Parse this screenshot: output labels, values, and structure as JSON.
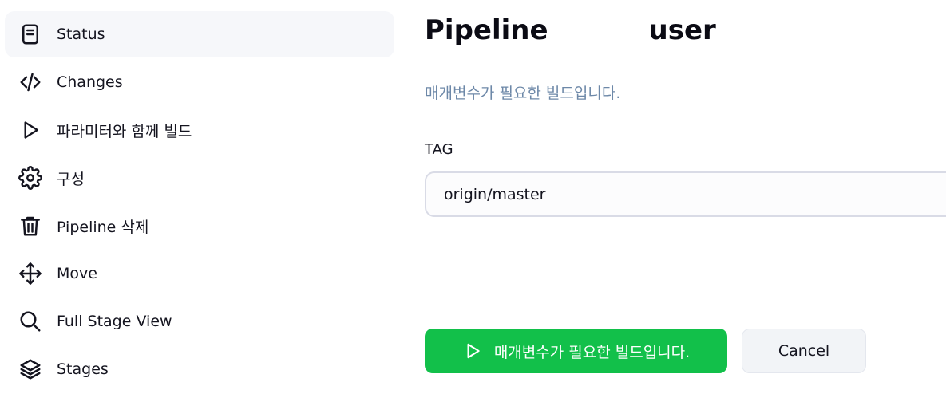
{
  "sidebar": {
    "items": [
      {
        "label": "Status",
        "icon": "document-icon",
        "active": true
      },
      {
        "label": "Changes",
        "icon": "code-icon"
      },
      {
        "label": "파라미터와 함께 빌드",
        "icon": "play-icon"
      },
      {
        "label": "구성",
        "icon": "gear-icon"
      },
      {
        "label": "Pipeline 삭제",
        "icon": "trash-icon"
      },
      {
        "label": "Move",
        "icon": "move-arrows-icon"
      },
      {
        "label": "Full Stage View",
        "icon": "search-icon"
      },
      {
        "label": "Stages",
        "icon": "layers-icon"
      }
    ]
  },
  "main": {
    "title_part1": "Pipeline",
    "title_part2": "user",
    "description": "매개변수가 필요한 빌드입니다.",
    "parameter": {
      "label": "TAG",
      "value": "origin/master"
    },
    "build_button": {
      "label": "매개변수가 필요한 빌드입니다.",
      "icon": "play-icon"
    },
    "cancel_button": {
      "label": "Cancel"
    }
  },
  "colors": {
    "build_button": "#12c04a",
    "description_text": "#6d88a8",
    "active_item_bg": "#f6f7fa"
  }
}
